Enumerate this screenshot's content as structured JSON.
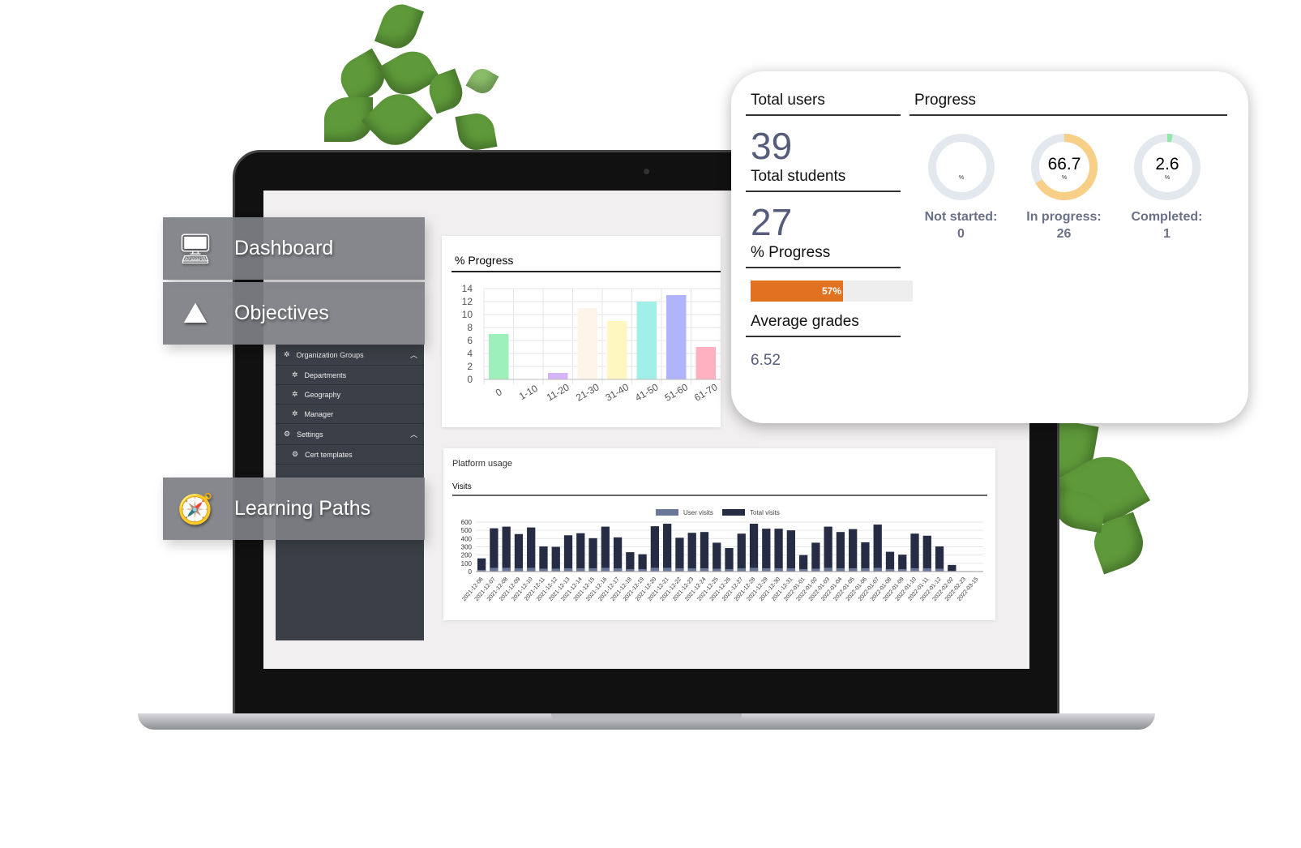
{
  "tiles": [
    {
      "label": "Dashboard",
      "icon": "dashboard-monitor-icon"
    },
    {
      "label": "Objectives",
      "icon": "mountain-flag-icon"
    },
    {
      "label": "Learning Paths",
      "icon": "compass-icon"
    }
  ],
  "sidebar": {
    "items": [
      {
        "label": "Organization Groups",
        "icon": "network-icon",
        "expanded": true
      },
      {
        "label": "Departments",
        "icon": "network-icon"
      },
      {
        "label": "Geography",
        "icon": "network-icon"
      },
      {
        "label": "Manager",
        "icon": "network-icon"
      },
      {
        "label": "Settings",
        "icon": "gear-icon",
        "expanded": true
      },
      {
        "label": "Cert templates",
        "icon": "gear-icon"
      }
    ]
  },
  "progress_card": {
    "title": "% Progress"
  },
  "usage_card": {
    "title": "Platform usage",
    "subtitle": "Visits"
  },
  "overview": {
    "total_users": {
      "title": "Total users",
      "value": "39"
    },
    "total_students": {
      "title": "Total students",
      "value": "27"
    },
    "progress_bar": {
      "title": "% Progress",
      "value": 57,
      "label": "57%",
      "color": "#e07222"
    },
    "average_grades": {
      "title": "Average grades",
      "value": "6.52"
    },
    "progress": {
      "title": "Progress",
      "donuts": [
        {
          "value": "",
          "unit": "%",
          "pct": 0,
          "label": "Not started: 0",
          "color": "#e3e8ef"
        },
        {
          "value": "66.7",
          "unit": "%",
          "pct": 66.7,
          "label": "In progress: 26",
          "color": "#f8cf87"
        },
        {
          "value": "2.6",
          "unit": "%",
          "pct": 2.6,
          "label": "Completed: 1",
          "color": "#8ee8a8"
        }
      ]
    }
  },
  "chart_data": [
    {
      "type": "bar",
      "title": "% Progress",
      "categories": [
        "0",
        "1-10",
        "11-20",
        "21-30",
        "31-40",
        "41-50",
        "51-60",
        "61-70"
      ],
      "values": [
        7,
        0,
        1,
        11,
        9,
        12,
        13,
        5
      ],
      "ylim": [
        0,
        14
      ],
      "yticks": [
        0,
        2,
        4,
        6,
        8,
        10,
        12,
        14
      ],
      "colors": [
        "#9ef0ba",
        "#ffb1c1",
        "#d4b6f8",
        "#fff4ea",
        "#fff6c0",
        "#a0efe9",
        "#b0b5fb",
        "#ffb1c1"
      ],
      "grid": true
    },
    {
      "type": "bar",
      "title": "Platform usage",
      "ylim": [
        0,
        600
      ],
      "yticks": [
        0,
        100,
        200,
        300,
        400,
        500,
        600
      ],
      "legend": "top",
      "grid": true,
      "categories": [
        "2021-12-06",
        "2021-12-07",
        "2021-12-08",
        "2021-12-09",
        "2021-12-10",
        "2021-12-11",
        "2021-12-12",
        "2021-12-13",
        "2021-12-14",
        "2021-12-15",
        "2021-12-16",
        "2021-12-17",
        "2021-12-18",
        "2021-12-19",
        "2021-12-20",
        "2021-12-21",
        "2021-12-22",
        "2021-12-23",
        "2021-12-24",
        "2021-12-25",
        "2021-12-26",
        "2021-12-27",
        "2021-12-28",
        "2021-12-29",
        "2021-12-30",
        "2021-12-31",
        "2022-01-01",
        "2022-01-02",
        "2022-01-03",
        "2022-01-04",
        "2022-01-05",
        "2022-01-06",
        "2022-01-07",
        "2022-01-08",
        "2022-01-09",
        "2022-01-10",
        "2022-01-11",
        "2022-01-12",
        "2022-02-02",
        "2022-02-23",
        "2022-03-15"
      ],
      "series": [
        {
          "name": "User visits",
          "color": "#6b7799",
          "values": [
            20,
            45,
            45,
            40,
            45,
            35,
            35,
            40,
            40,
            40,
            45,
            40,
            30,
            30,
            45,
            45,
            40,
            40,
            40,
            35,
            30,
            40,
            45,
            40,
            40,
            40,
            30,
            35,
            45,
            40,
            40,
            40,
            45,
            30,
            30,
            40,
            40,
            35,
            10,
            0,
            0
          ]
        },
        {
          "name": "Total visits",
          "color": "#262c44",
          "values": [
            160,
            525,
            545,
            455,
            535,
            305,
            300,
            440,
            465,
            405,
            545,
            415,
            235,
            210,
            550,
            580,
            410,
            470,
            480,
            350,
            285,
            460,
            580,
            520,
            520,
            500,
            200,
            350,
            545,
            480,
            515,
            355,
            570,
            240,
            205,
            460,
            435,
            305,
            80,
            0,
            0
          ]
        }
      ]
    }
  ]
}
